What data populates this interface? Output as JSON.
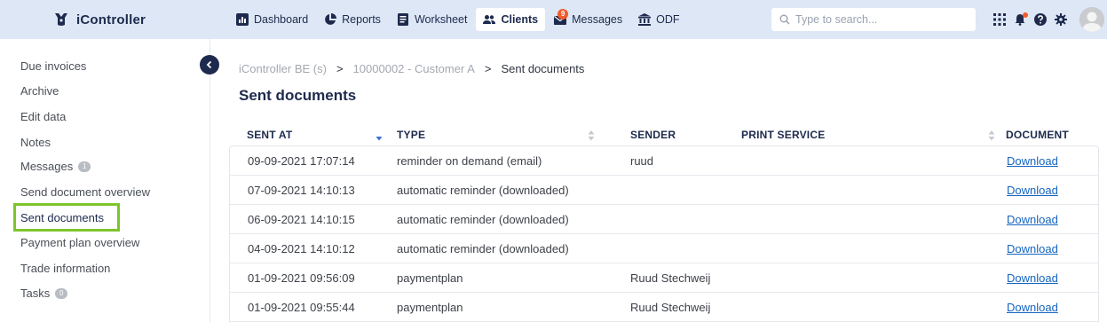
{
  "app": {
    "name": "iController"
  },
  "nav": {
    "items": [
      {
        "label": "Dashboard",
        "icon": "chart-icon"
      },
      {
        "label": "Reports",
        "icon": "pie-chart-icon"
      },
      {
        "label": "Worksheet",
        "icon": "worksheet-icon"
      },
      {
        "label": "Clients",
        "icon": "users-icon",
        "active": true
      },
      {
        "label": "Messages",
        "icon": "envelope-icon",
        "badge": "9"
      },
      {
        "label": "ODF",
        "icon": "bank-icon"
      }
    ]
  },
  "search": {
    "placeholder": "Type to search..."
  },
  "sidebar": {
    "items": [
      {
        "label": "Due invoices"
      },
      {
        "label": "Archive"
      },
      {
        "label": "Edit data"
      },
      {
        "label": "Notes"
      },
      {
        "label": "Messages",
        "count": "1"
      },
      {
        "label": "Send document overview"
      },
      {
        "label": "Sent documents",
        "selected": true
      },
      {
        "label": "Payment plan overview"
      },
      {
        "label": "Trade information"
      },
      {
        "label": "Tasks",
        "count": "0"
      }
    ]
  },
  "breadcrumb": {
    "items": [
      "iController BE (s)",
      "10000002 - Customer A",
      "Sent documents"
    ],
    "separator": ">"
  },
  "page": {
    "title": "Sent documents"
  },
  "table": {
    "columns": {
      "sent_at": "SENT AT",
      "type": "TYPE",
      "sender": "SENDER",
      "print_service": "PRINT SERVICE",
      "document": "DOCUMENT"
    },
    "rows": [
      {
        "sent_at": "09-09-2021 17:07:14",
        "type": "reminder on demand (email)",
        "sender": "ruud",
        "print_service": "",
        "document": "Download"
      },
      {
        "sent_at": "07-09-2021 14:10:13",
        "type": "automatic reminder (downloaded)",
        "sender": "",
        "print_service": "",
        "document": "Download"
      },
      {
        "sent_at": "06-09-2021 14:10:15",
        "type": "automatic reminder (downloaded)",
        "sender": "",
        "print_service": "",
        "document": "Download"
      },
      {
        "sent_at": "04-09-2021 14:10:12",
        "type": "automatic reminder (downloaded)",
        "sender": "",
        "print_service": "",
        "document": "Download"
      },
      {
        "sent_at": "01-09-2021 09:56:09",
        "type": "paymentplan",
        "sender": "Ruud Stechweij",
        "print_service": "",
        "document": "Download"
      },
      {
        "sent_at": "01-09-2021 09:55:44",
        "type": "paymentplan",
        "sender": "Ruud Stechweij",
        "print_service": "",
        "document": "Download"
      }
    ]
  },
  "colors": {
    "topbar_bg": "#dde7f6",
    "brand_dark": "#1d2a4d",
    "link": "#1565c0",
    "highlight": "#7dc42c",
    "badge": "#f15a2b"
  }
}
